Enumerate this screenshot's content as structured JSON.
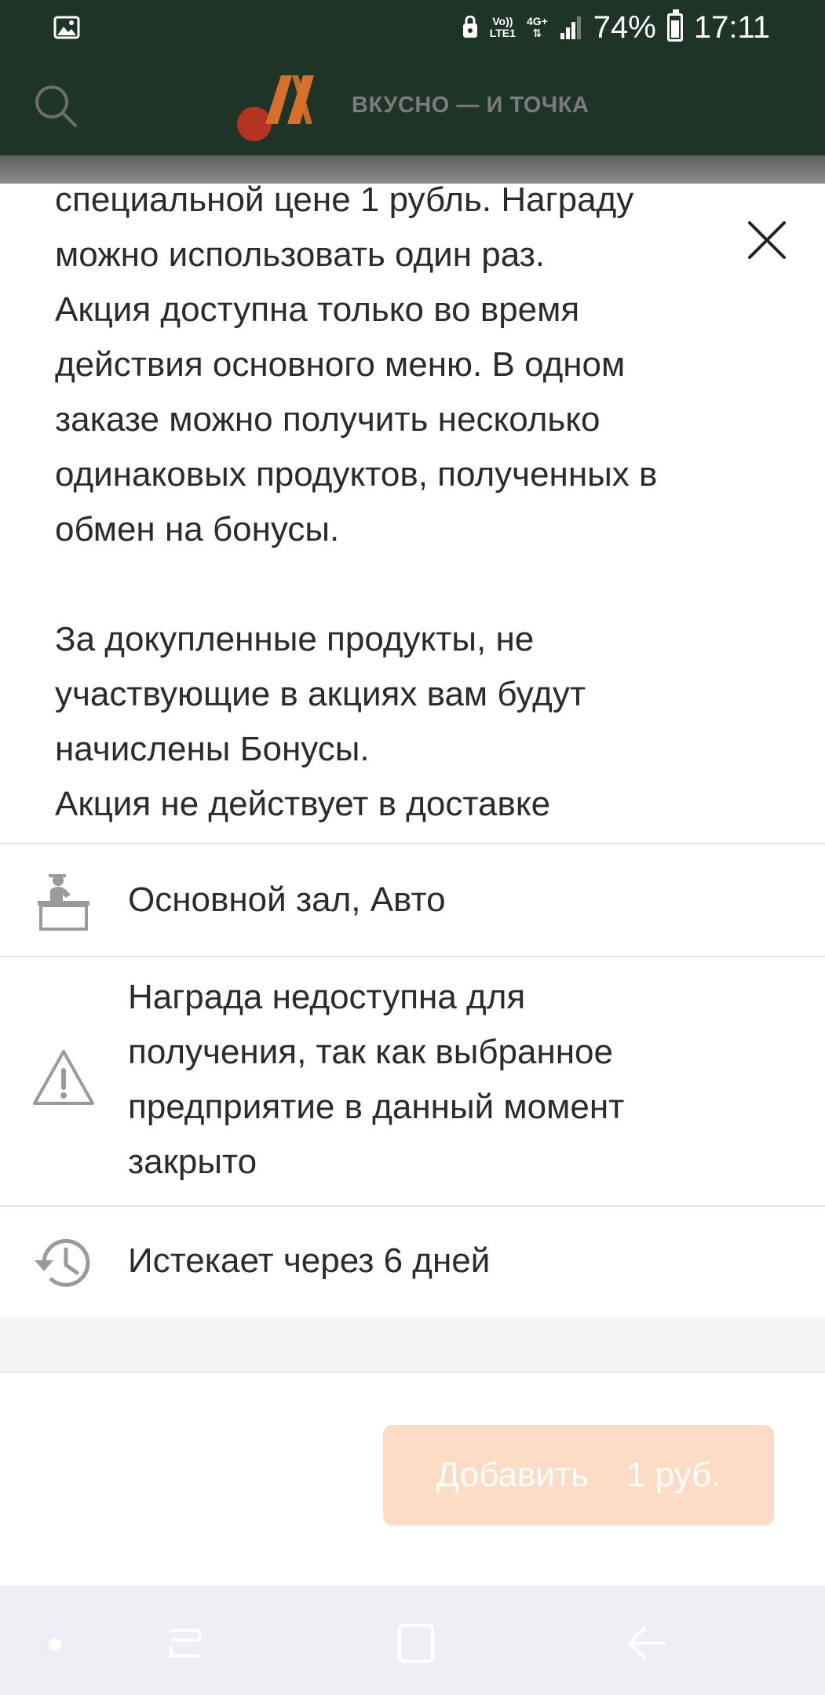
{
  "status_bar": {
    "volte": "Vo))",
    "lte": "LTE1",
    "network": "4G+",
    "battery": "74%",
    "time": "17:11",
    "icons": [
      "image-icon",
      "signal-icon",
      "battery-icon"
    ]
  },
  "header": {
    "brand": "ВКУСНО — И ТОЧКА",
    "icons": [
      "search-icon",
      "logo-icon"
    ],
    "colors": {
      "background": "#1d3426",
      "logo_red": "#c0341d",
      "logo_orange": "#e8832f"
    }
  },
  "reward": {
    "description_lines": [
      "специальной цене 1 рубль. Награду",
      "можно использовать один раз.",
      "Акция доступна только во время",
      "действия основного меню. В одном",
      "заказе можно получить несколько",
      "одинаковых продуктов, полученных в",
      "обмен на бонусы."
    ],
    "note_lines": [
      "За докупленные продукты, не",
      "участвующие в акциях вам будут",
      "начислены Бонусы.",
      "Акция не действует в доставке"
    ],
    "hall": "Основной зал, Авто",
    "warning_lines": [
      "Награда недоступна для",
      "получения, так как выбранное",
      "предприятие в данный момент",
      "закрыто"
    ],
    "expires": "Истекает через 6 дней",
    "icons": [
      "close-icon",
      "counter-icon",
      "warning-icon",
      "history-icon"
    ]
  },
  "action": {
    "add_label": "Добавить",
    "price": "1 руб.",
    "color": "#fcdcc4",
    "disabled": true
  },
  "nav_bar": {
    "icons": [
      "dot-icon",
      "recents-icon",
      "home-icon",
      "back-icon"
    ]
  }
}
